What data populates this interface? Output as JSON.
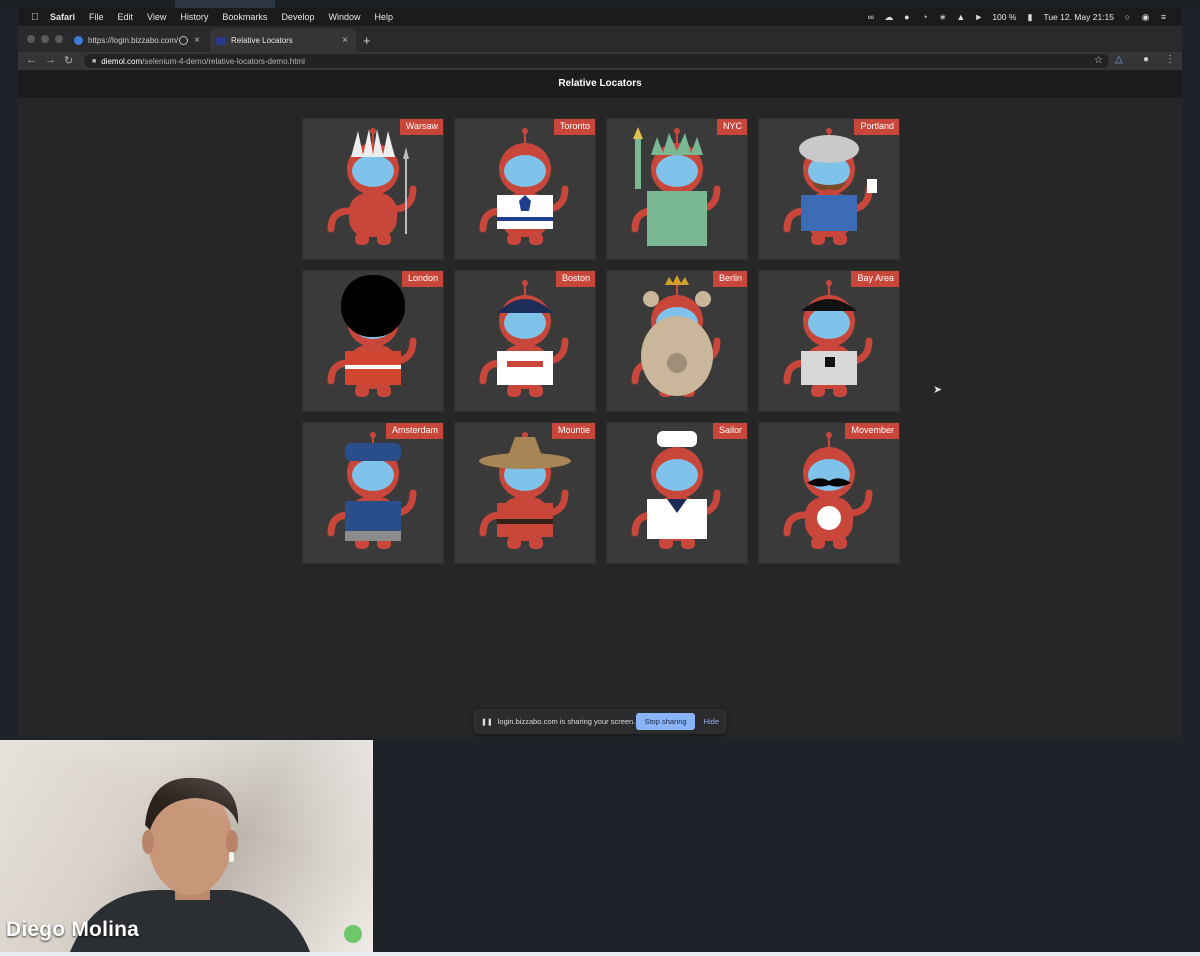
{
  "menubar": {
    "app": "Safari",
    "items": [
      "File",
      "Edit",
      "View",
      "History",
      "Bookmarks",
      "Develop",
      "Window",
      "Help"
    ],
    "battery": "100 %",
    "datetime": "Tue 12. May  21:15"
  },
  "tabs": [
    {
      "title": "https://login.bizzabo.com/",
      "favicon_color": "#3d7bd9"
    },
    {
      "title": "Relative Locators",
      "favicon_color": "#2b3a8c"
    }
  ],
  "address": {
    "domain": "diemol.com",
    "path": "/selenium-4-demo/relative-locators-demo.html"
  },
  "page": {
    "title": "Relative Locators",
    "cards": [
      {
        "city": "Warsaw",
        "theme": "warrior-feathers"
      },
      {
        "city": "Toronto",
        "theme": "hockey-jersey"
      },
      {
        "city": "NYC",
        "theme": "statue-of-liberty"
      },
      {
        "city": "Portland",
        "theme": "hipster-coffee"
      },
      {
        "city": "London",
        "theme": "royal-guard"
      },
      {
        "city": "Boston",
        "theme": "red-sox"
      },
      {
        "city": "Berlin",
        "theme": "bear"
      },
      {
        "city": "Bay Area",
        "theme": "giants"
      },
      {
        "city": "Amsterdam",
        "theme": "cap-suspenders"
      },
      {
        "city": "Mountie",
        "theme": "mountie-hat"
      },
      {
        "city": "Sailor",
        "theme": "sailor"
      },
      {
        "city": "Movember",
        "theme": "moustache"
      }
    ]
  },
  "share_bar": {
    "message": "login.bizzabo.com is sharing your screen.",
    "stop_label": "Stop sharing",
    "hide_label": "Hide"
  },
  "webcam": {
    "name": "Diego Molina"
  },
  "colors": {
    "accent": "#c8463a",
    "visor": "#7fc3ea",
    "share_button": "#8ab4f8"
  }
}
